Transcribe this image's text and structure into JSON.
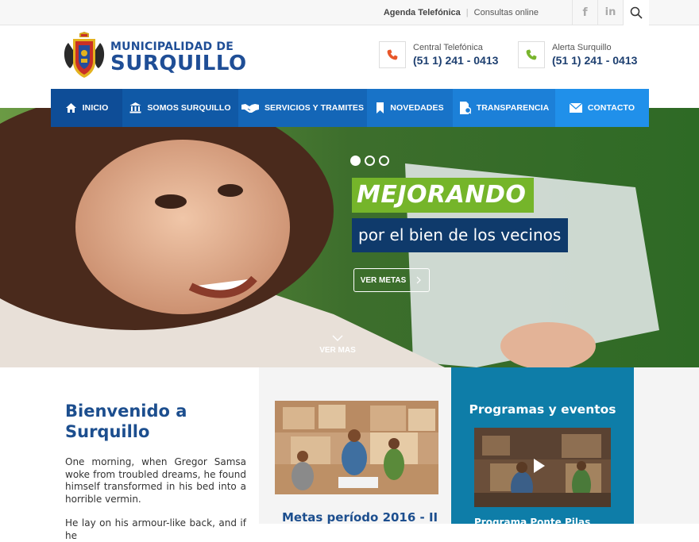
{
  "topbar": {
    "agenda": "Agenda Telefónica",
    "separator": "|",
    "consultas": "Consultas online",
    "social": [
      {
        "icon": "facebook-icon",
        "glyph": "f"
      },
      {
        "icon": "linkedin-icon",
        "glyph": "in"
      },
      {
        "icon": "youtube-icon",
        "glyph": "▶"
      }
    ],
    "search_icon": "search-icon"
  },
  "header": {
    "logo_line1": "MUNICIPALIDAD DE",
    "logo_line2": "SURQUILLO",
    "contacts": [
      {
        "label": "Central Telefónica",
        "number": "(51 1) 241 - 0413",
        "icon": "phone-icon",
        "color": "#e8572a"
      },
      {
        "label": "Alerta Surquillo",
        "number": "(51 1) 241 - 0413",
        "icon": "phone-icon",
        "color": "#79b52e"
      }
    ]
  },
  "nav": {
    "items": [
      {
        "label": "INICIO",
        "icon": "home-icon",
        "color": "#0e4d97"
      },
      {
        "label": "SOMOS SURQUILLO",
        "icon": "building-icon",
        "color": "#1059a6"
      },
      {
        "label": "SERVICIOS Y TRAMITES",
        "icon": "handshake-icon",
        "color": "#1466b7"
      },
      {
        "label": "NOVEDADES",
        "icon": "bookmark-icon",
        "color": "#1873c8"
      },
      {
        "label": "TRANSPARENCIA",
        "icon": "document-icon",
        "color": "#1c80d8"
      },
      {
        "label": "CONTACTO",
        "icon": "envelope-icon",
        "color": "#2090ea"
      }
    ]
  },
  "hero": {
    "slides": 3,
    "active_slide": 1,
    "title": "MEJORANDO",
    "subtitle": "por el bien de los vecinos",
    "button": "VER METAS",
    "more": "VER MAS",
    "title_bg": "#75b52a",
    "subtitle_bg": "#0f3a6b"
  },
  "welcome": {
    "title": "Bienvenido a Surquillo",
    "paragraph1": "One morning, when Gregor Samsa woke from troubled dreams, he found himself transformed in his bed into a horrible vermin.",
    "paragraph2": "He lay on his armour-like back, and if he"
  },
  "metas": {
    "title": "Metas período 2016 - II"
  },
  "programas": {
    "title": "Programas y eventos",
    "caption": "Programa Ponte Pilas",
    "bg": "#0e7da8"
  }
}
